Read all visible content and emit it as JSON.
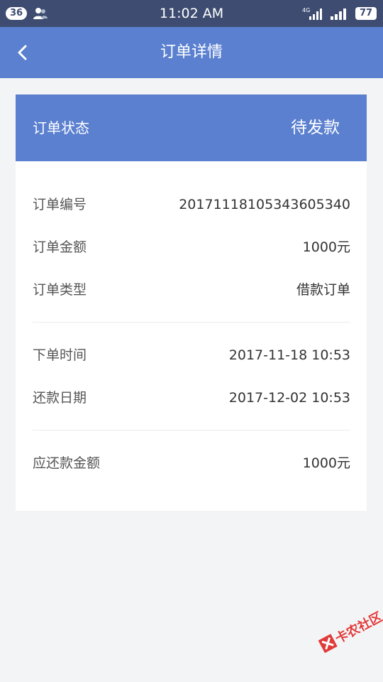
{
  "status_bar": {
    "notification_count": "36",
    "time": "11:02 AM",
    "network": "4G",
    "battery": "77"
  },
  "nav": {
    "title": "订单详情",
    "back_icon": "chevron-left-icon"
  },
  "order_status": {
    "label": "订单状态",
    "value": "待发款"
  },
  "details": {
    "order_number": {
      "label": "订单编号",
      "value": "20171118105343605340"
    },
    "order_amount": {
      "label": "订单金额",
      "value": "1000元"
    },
    "order_type": {
      "label": "订单类型",
      "value": "借款订单"
    },
    "order_time": {
      "label": "下单时间",
      "value": "2017-11-18 10:53"
    },
    "repay_date": {
      "label": "还款日期",
      "value": "2017-12-02 10:53"
    },
    "repay_amount": {
      "label": "应还款金额",
      "value": "1000元"
    }
  },
  "watermark": {
    "text": "卡农社区"
  },
  "colors": {
    "status_bar": "#3d4c70",
    "accent": "#5b80d0",
    "background": "#f3f4f6",
    "watermark": "#e03a3a"
  }
}
